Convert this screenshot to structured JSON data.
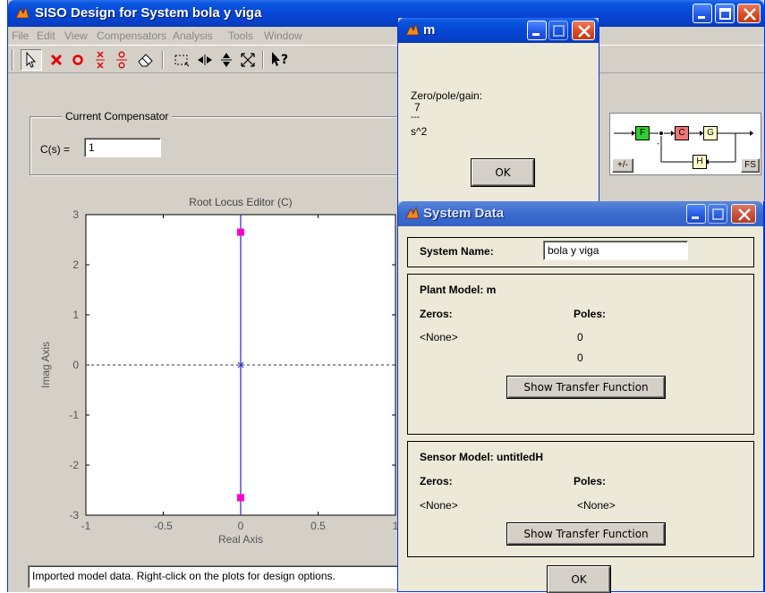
{
  "main_window": {
    "title": "SISO Design for System bola y viga",
    "menu": [
      "File",
      "Edit",
      "View",
      "Compensators",
      "Analysis",
      "Tools",
      "Window"
    ],
    "compensator": {
      "group_label": "Current Compensator",
      "cs_label": "C(s) =",
      "cs_value": "1"
    },
    "block_diagram": {
      "blocks": [
        "F",
        "C",
        "G",
        "H"
      ],
      "sign_toggle": "+/-",
      "fs_button": "FS"
    },
    "status_text": "Imported model data. Right-click on the plots for design options."
  },
  "chart_data": {
    "type": "scatter",
    "title": "Root Locus Editor (C)",
    "xlabel": "Real Axis",
    "ylabel": "Imag Axis",
    "xlim": [
      -1,
      1
    ],
    "ylim": [
      -3,
      3
    ],
    "xticks": [
      "-1",
      "-0.5",
      "0",
      "0.5",
      "1"
    ],
    "yticks": [
      "-3",
      "-2",
      "-1",
      "0",
      "1",
      "2",
      "3"
    ],
    "locus_line": {
      "x": [
        0,
        0
      ],
      "y": [
        -3,
        3
      ]
    },
    "closed_loop_poles": [
      {
        "x": 0,
        "y": 2.65
      },
      {
        "x": 0,
        "y": -2.65
      }
    ],
    "open_loop_poles": [
      {
        "x": 0,
        "y": 0
      }
    ],
    "zero_line_style": "dashed",
    "colors": {
      "locus": "#3333cc",
      "closed_loop_pole": "#ff00cc",
      "pole_marker": "#3333cc"
    }
  },
  "m_window": {
    "title": "m",
    "heading": "Zero/pole/gain:",
    "numerator": "7",
    "separator": "---",
    "denominator": "s^2",
    "ok_label": "OK"
  },
  "system_data_window": {
    "title": "System Data",
    "system_name_label": "System Name:",
    "system_name_value": "bola y viga",
    "plant": {
      "heading": "Plant Model:  m",
      "zeros_label": "Zeros:",
      "poles_label": "Poles:",
      "zeros": [
        "<None>"
      ],
      "poles": [
        "0",
        "0"
      ],
      "show_tf_label": "Show Transfer Function"
    },
    "sensor": {
      "heading": "Sensor Model:  untitledH",
      "zeros_label": "Zeros:",
      "poles_label": "Poles:",
      "zeros": [
        "<None>"
      ],
      "poles": [
        "<None>"
      ],
      "show_tf_label": "Show Transfer Function"
    },
    "ok_label": "OK"
  },
  "colors": {
    "xp_title_blue": "#0646d6",
    "window_face": "#d4d0c8",
    "block_f": "#33cc33",
    "block_c": "#ee7777",
    "block_g": "#ffffcc",
    "block_h": "#ffffcc"
  }
}
